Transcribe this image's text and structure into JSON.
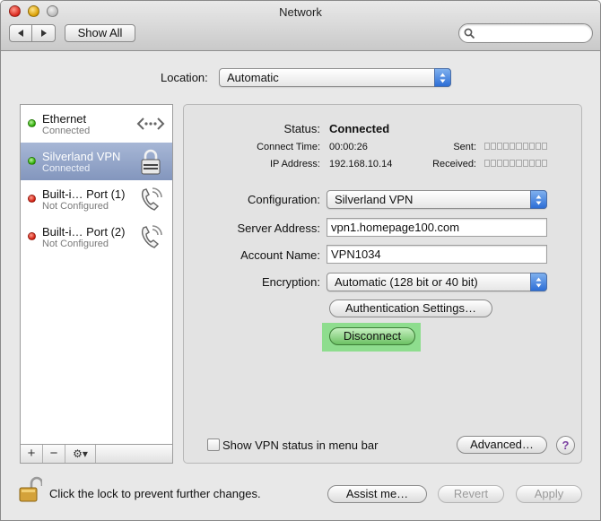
{
  "window": {
    "title": "Network"
  },
  "toolbar": {
    "show_all_label": "Show All",
    "search_placeholder": ""
  },
  "location": {
    "label": "Location:",
    "value": "Automatic"
  },
  "services": [
    {
      "name": "Ethernet",
      "status": "Connected",
      "status_color": "green",
      "icon": "ethernet-arrows-icon"
    },
    {
      "name": "Silverland VPN",
      "status": "Connected",
      "status_color": "green",
      "icon": "vpn-lock-icon",
      "selected": true
    },
    {
      "name": "Built-i… Port (1)",
      "status": "Not Configured",
      "status_color": "red",
      "icon": "phone-icon"
    },
    {
      "name": "Built-i… Port (2)",
      "status": "Not Configured",
      "status_color": "red",
      "icon": "phone-icon"
    }
  ],
  "sidebar_controls": {
    "add": "+",
    "remove": "−",
    "gear": "⚙▾"
  },
  "status": {
    "label": "Status:",
    "value": "Connected",
    "connect_time_label": "Connect Time:",
    "connect_time": "00:00:26",
    "ip_label": "IP Address:",
    "ip": "192.168.10.14",
    "sent_label": "Sent:",
    "received_label": "Received:"
  },
  "form": {
    "configuration_label": "Configuration:",
    "configuration_value": "Silverland VPN",
    "server_label": "Server Address:",
    "server_value": "vpn1.homepage100.com",
    "account_label": "Account Name:",
    "account_value": "VPN1034",
    "encryption_label": "Encryption:",
    "encryption_value": "Automatic (128 bit or 40 bit)",
    "auth_button": "Authentication Settings…",
    "disconnect_button": "Disconnect"
  },
  "panel_footer": {
    "show_status_label": "Show VPN status in menu bar",
    "advanced_button": "Advanced…",
    "help": "?"
  },
  "footer": {
    "lock_text": "Click the lock to prevent further changes.",
    "assist_button": "Assist me…",
    "revert_button": "Revert",
    "apply_button": "Apply"
  },
  "colors": {
    "highlight": "#8edd8e",
    "selection": "#8fa1c6",
    "accent_blue": "#2d6ed6"
  }
}
